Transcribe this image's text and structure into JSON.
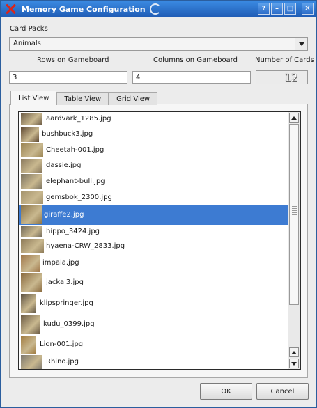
{
  "window": {
    "title": "Memory Game Configuration"
  },
  "titlebar_buttons": {
    "help": "?",
    "minimize": "–",
    "maximize": "□",
    "close": "✕"
  },
  "card_packs": {
    "label": "Card Packs",
    "selected": "Animals"
  },
  "rows": {
    "label": "Rows on Gameboard",
    "value": "3"
  },
  "columns": {
    "label": "Columns on Gameboard",
    "value": "4"
  },
  "cards": {
    "label": "Number of Cards",
    "value": "12"
  },
  "tabs": [
    {
      "label": "List View",
      "active": true
    },
    {
      "label": "Table View",
      "active": false
    },
    {
      "label": "Grid View",
      "active": false
    }
  ],
  "files": [
    {
      "name": "aardvark_1285.jpg",
      "color": "#6b5a44",
      "selected": false
    },
    {
      "name": "bushbuck3.jpg",
      "color": "#5c4631",
      "selected": false
    },
    {
      "name": "Cheetah-001.jpg",
      "color": "#9a8452",
      "selected": false
    },
    {
      "name": "dassie.jpg",
      "color": "#8a7a5e",
      "selected": false
    },
    {
      "name": "elephant-bull.jpg",
      "color": "#7b7360",
      "selected": false
    },
    {
      "name": "gemsbok_2300.jpg",
      "color": "#a3926b",
      "selected": false
    },
    {
      "name": "giraffe2.jpg",
      "color": "#8c7448",
      "selected": true
    },
    {
      "name": "hippo_3424.jpg",
      "color": "#6f6757",
      "selected": false
    },
    {
      "name": "hyaena-CRW_2833.jpg",
      "color": "#8d7a58",
      "selected": false
    },
    {
      "name": "impala.jpg",
      "color": "#a0774a",
      "selected": false
    },
    {
      "name": "jackal3.jpg",
      "color": "#8a6a3e",
      "selected": false
    },
    {
      "name": "klipspringer.jpg",
      "color": "#5d5242",
      "selected": false
    },
    {
      "name": "kudu_0399.jpg",
      "color": "#6a5a44",
      "selected": false
    },
    {
      "name": "Lion-001.jpg",
      "color": "#a07a3e",
      "selected": false
    },
    {
      "name": "Rhino.jpg",
      "color": "#7d786e",
      "selected": false
    }
  ],
  "buttons": {
    "ok": "OK",
    "cancel": "Cancel"
  }
}
